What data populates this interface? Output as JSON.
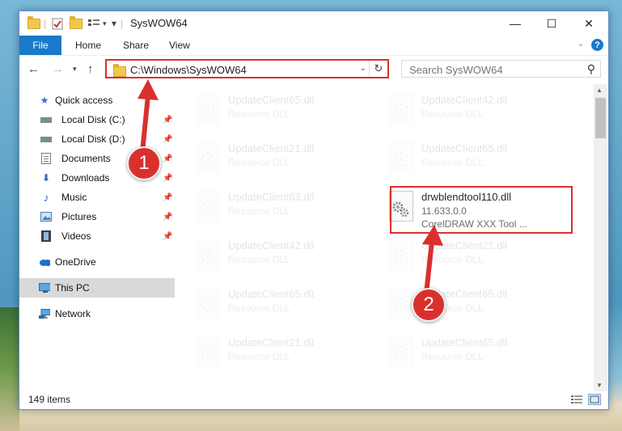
{
  "window": {
    "title": "SysWOW64",
    "minimize_glyph": "—",
    "maximize_glyph": "☐",
    "close_glyph": "✕"
  },
  "ribbon": {
    "tabs": [
      "File",
      "Home",
      "Share",
      "View"
    ],
    "help_glyph": "?"
  },
  "nav": {
    "address": "C:\\Windows\\SysWOW64",
    "search_placeholder": "Search SysWOW64"
  },
  "sidebar": {
    "items": [
      {
        "label": "Quick access",
        "icon": "star-icon",
        "pinned": false
      },
      {
        "label": "Local Disk (C:)",
        "icon": "drive-icon",
        "pinned": true
      },
      {
        "label": "Local Disk (D:)",
        "icon": "drive-icon",
        "pinned": true
      },
      {
        "label": "Documents",
        "icon": "documents-icon",
        "pinned": true
      },
      {
        "label": "Downloads",
        "icon": "download-icon",
        "pinned": true
      },
      {
        "label": "Music",
        "icon": "music-icon",
        "pinned": true
      },
      {
        "label": "Pictures",
        "icon": "pictures-icon",
        "pinned": true
      },
      {
        "label": "Videos",
        "icon": "videos-icon",
        "pinned": true
      },
      {
        "label": "OneDrive",
        "icon": "cloud-icon",
        "pinned": false
      },
      {
        "label": "This PC",
        "icon": "computer-icon",
        "pinned": false,
        "selected": true
      },
      {
        "label": "Network",
        "icon": "network-icon",
        "pinned": false
      }
    ]
  },
  "files": [
    {
      "name": "UpdateClient65.dll",
      "line2": "Resource DLL",
      "line3": ""
    },
    {
      "name": "UpdateClient42.dll",
      "line2": "Resource DLL",
      "line3": ""
    },
    {
      "name": "UpdateClient21.dll",
      "line2": "Resource DLL",
      "line3": ""
    },
    {
      "name": "UpdateClient65.dll",
      "line2": "Resource DLL",
      "line3": ""
    },
    {
      "name": "UpdateClient63.dll",
      "line2": "Resource DLL",
      "line3": ""
    },
    {
      "name": "drwblendtool110.dll",
      "line2": "11.633.0.0",
      "line3": "CorelDRAW XXX Tool ...",
      "highlighted": true
    },
    {
      "name": "UpdateClient42.dll",
      "line2": "Resource DLL",
      "line3": ""
    },
    {
      "name": "UpdateClient21.dll",
      "line2": "Resource DLL",
      "line3": ""
    },
    {
      "name": "UpdateClient65.dll",
      "line2": "Resource DLL",
      "line3": ""
    },
    {
      "name": "UpdateClient65.dll",
      "line2": "Resource DLL",
      "line3": ""
    },
    {
      "name": "UpdateClient21.dll",
      "line2": "Resource DLL",
      "line3": ""
    },
    {
      "name": "UpdateClient65.dll",
      "line2": "Resource DLL",
      "line3": ""
    }
  ],
  "status": {
    "item_count": "149 items"
  },
  "annotations": {
    "step1": "1",
    "step2": "2",
    "color": "#d9302d"
  }
}
